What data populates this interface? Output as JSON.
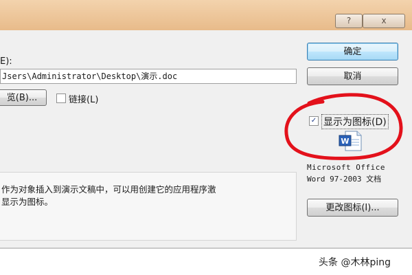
{
  "titlebar": {
    "help_label": "?",
    "close_label": "x"
  },
  "form": {
    "filename_label": "E):",
    "filename_value": "Jsers\\Administrator\\Desktop\\演示.doc",
    "browse_label": "览(B)...",
    "link_label": "链接(L)"
  },
  "buttons": {
    "ok_label": "确定",
    "cancel_label": "取消",
    "change_icon_label": "更改图标(I)..."
  },
  "display_as_icon": {
    "label": "显示为图标(D)",
    "checked": true
  },
  "icon_caption": {
    "line1": "Microsoft Office",
    "line2": "Word 97-2003 文档"
  },
  "result": {
    "line1": "作为对象插入到演示文稿中，可以用创建它的应用程序激",
    "line2": "显示为图标。"
  },
  "watermark": {
    "text": "头条 @木林ping"
  },
  "colors": {
    "annotation_circle": "#e3111b",
    "titlebar": "#e8bb8a",
    "dialog_bg": "#f0f0f0"
  }
}
